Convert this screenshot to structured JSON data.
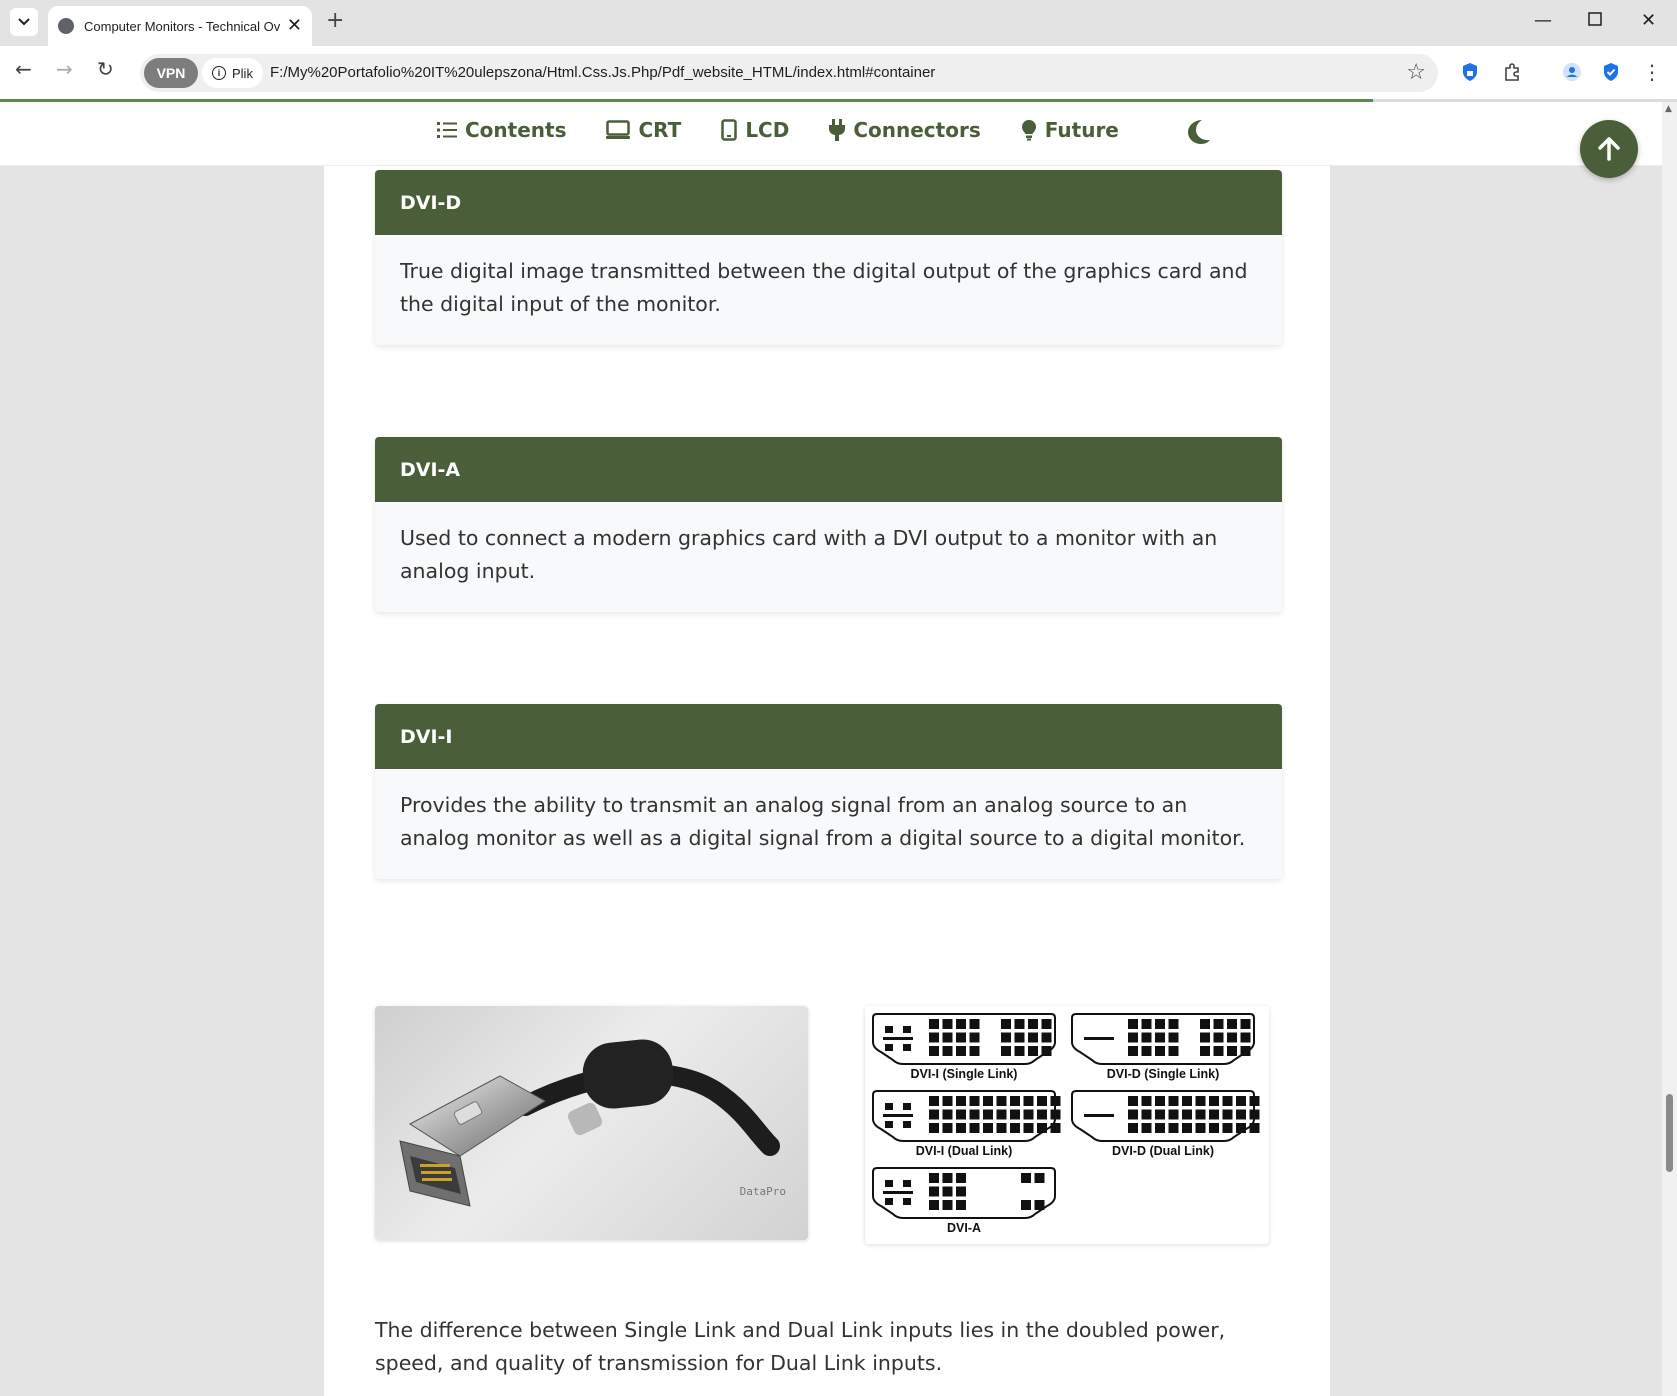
{
  "browser": {
    "tab_title": "Computer Monitors - Technical Ov",
    "vpn_label": "VPN",
    "site_info_label": "Plik",
    "url": "F:/My%20Portafolio%20IT%20ulepszona/Html.Css.Js.Php/Pdf_website_HTML/index.html#container",
    "icons": [
      "tab-list-icon",
      "globe-icon",
      "close-icon",
      "plus-icon",
      "minimize-icon",
      "maximize-icon",
      "close-window-icon",
      "back-icon",
      "forward-icon",
      "reload-icon",
      "info-icon",
      "star-icon",
      "shield-lock-icon",
      "puzzle-icon",
      "profile-icon",
      "shield-check-icon",
      "more-icon"
    ]
  },
  "nav": {
    "items": [
      {
        "label": "Contents",
        "icon": "list-icon"
      },
      {
        "label": "CRT",
        "icon": "monitor-icon"
      },
      {
        "label": "LCD",
        "icon": "tablet-icon"
      },
      {
        "label": "Connectors",
        "icon": "plug-icon"
      },
      {
        "label": "Future",
        "icon": "lightbulb-icon"
      }
    ],
    "theme_toggle_icon": "moon-icon",
    "scroll_top_icon": "arrow-up-icon"
  },
  "cards": [
    {
      "title": "DVI-D",
      "text": "True digital image transmitted between the digital output of the graphics card and the digital input of the monitor."
    },
    {
      "title": "DVI-A",
      "text": "Used to connect a modern graphics card with a DVI output to a monitor with an analog input."
    },
    {
      "title": "DVI-I",
      "text": "Provides the ability to transmit an analog signal from an analog source to an analog monitor as well as a digital signal from a digital source to a digital monitor."
    }
  ],
  "photo": {
    "caption": "DataPro"
  },
  "diagram": {
    "labels": [
      "DVI-I (Single Link)",
      "DVI-D (Single Link)",
      "DVI-I (Dual Link)",
      "DVI-D (Dual Link)",
      "DVI-A"
    ]
  },
  "paragraph": "The difference between Single Link and Dual Link inputs lies in the doubled power, speed, and quality of transmission for Dual Link inputs.",
  "colors": {
    "accent": "#4a5e3a",
    "card_bg": "#f8f9fa",
    "page_bg": "#e4e4e4",
    "progress": "#5a8a4c"
  }
}
